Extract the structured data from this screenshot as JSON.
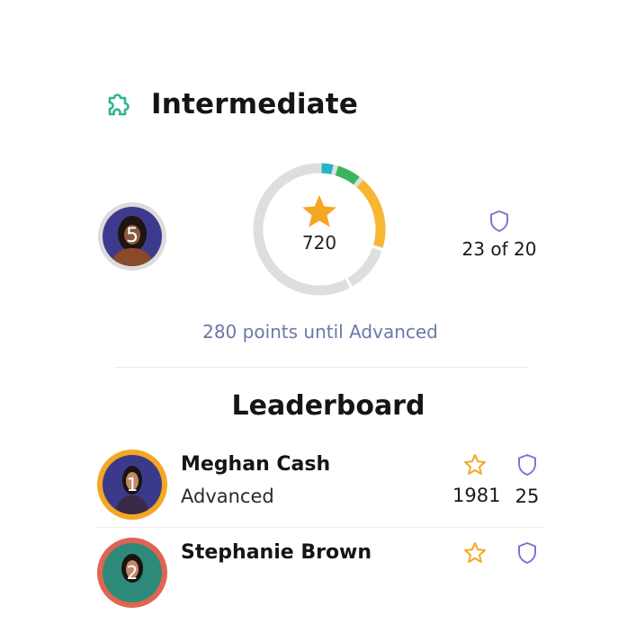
{
  "level": {
    "title": "Intermediate",
    "icon": "puzzle-icon",
    "accent": "#2fb58f"
  },
  "progress": {
    "rank": "5",
    "points": "720",
    "shield_stat": "23 of 20",
    "until_text": "280 points until Advanced",
    "segments": [
      {
        "color": "#26b4c6",
        "fraction": 0.04
      },
      {
        "color": "#3cb55a",
        "fraction": 0.07
      },
      {
        "color": "#f7b733",
        "fraction": 0.19
      }
    ],
    "track_color": "#dedede"
  },
  "leaderboard": {
    "title": "Leaderboard",
    "entries": [
      {
        "rank": "1",
        "name": "Meghan Cash",
        "level": "Advanced",
        "stars": "1981",
        "shields": "25",
        "ring_color": "#f5a623",
        "bg": "#3b3a8a"
      },
      {
        "rank": "2",
        "name": "Stephanie Brown",
        "level": "",
        "stars": "",
        "shields": "",
        "ring_color": "#e06452",
        "bg": "#2e8a78"
      }
    ]
  },
  "colors": {
    "star": "#f5a623",
    "shield": "#8b6fd0"
  }
}
